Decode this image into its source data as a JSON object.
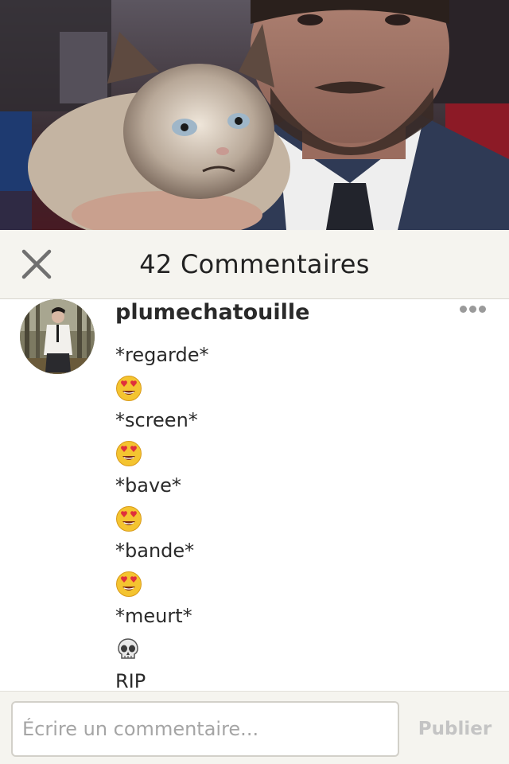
{
  "header": {
    "title": "42 Commentaires",
    "close_icon": "close-icon"
  },
  "comments": [
    {
      "author": "plumechatouille",
      "lines": [
        {
          "kind": "text",
          "text": "*regarde*"
        },
        {
          "kind": "emoji",
          "icon": "heart-eyes-emoji"
        },
        {
          "kind": "text",
          "text": "*screen*"
        },
        {
          "kind": "emoji",
          "icon": "heart-eyes-emoji"
        },
        {
          "kind": "text",
          "text": "*bave*"
        },
        {
          "kind": "emoji",
          "icon": "heart-eyes-emoji"
        },
        {
          "kind": "text",
          "text": "*bande*"
        },
        {
          "kind": "emoji",
          "icon": "heart-eyes-emoji"
        },
        {
          "kind": "text",
          "text": "*meurt*"
        },
        {
          "kind": "emoji",
          "icon": "skull-emoji"
        },
        {
          "kind": "text",
          "text": "RIP"
        }
      ]
    }
  ],
  "composer": {
    "placeholder": "Écrire un commentaire...",
    "value": "",
    "publish_label": "Publier"
  },
  "colors": {
    "header_bg": "#f5f4ef",
    "publish_disabled": "#c4c4c4",
    "emoji_face": "#f4c430"
  }
}
